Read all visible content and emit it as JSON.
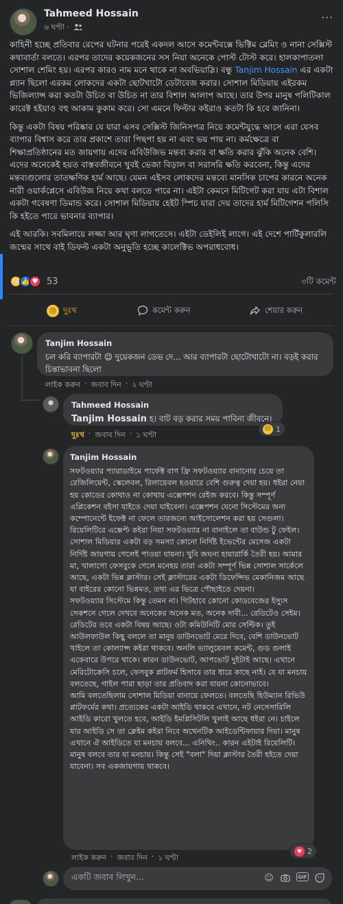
{
  "post": {
    "author": "Tahmeed Hossain",
    "time": "৬ ঘণ্টা ·",
    "audience_icon": "friends-icon",
    "more_icon": "more-icon",
    "paragraphs": [
      {
        "before": "কাহিনী হচ্ছে প্রতিবার রেপের ঘটনার পরেই একদল আসে কমেন্টবক্সে ভিক্টিম ব্লেমিং ও নানা সেক্সিস্ট কথাবার্তা বলতে।  এরপর তাদের কয়েকজনের সস নিয়া অনেকে পোস্ট টোস্ট করে। হালকাপাতলা সোশাল শেমিং হয়। এরপর কারও নাম মনে থাকে না অবভিয়াস্লি। বন্ধু ",
        "mention": "Tanjim Hossain",
        "after": " এর একটা প্ল্যান ছিলো এরকম লোকদের একটা ছোটখাটো ডেটাবেজ করার। সোশাল মিডিয়ায় এইরকম ভিজিল্যান্স করা কতটা উচিত বা উচিত না তার বিশাল আলাপ আছে। তার উপর মানুষ পলিটিকাল কারেক্ট হইয়াও বহু আকাম কুকাম করে। সো এমনে ফিল্টার কইরাও কতটা কি হবে জানিনা।"
      },
      {
        "text": "কিন্তু একটা বিষয় পরিষ্কার যে যারা এসব সেক্সিস্ট জিনিসপত্র নিয়ে কমেন্টযুদ্ধে আসে এরা যেসব ব্যাপার বিশ্বাস করে তার প্রকাশে তারা পিছপা হয় না এবং ভয় পায় না। কর্মক্ষেত্রে বা শিক্ষাপ্রতিষ্ঠানের মত জায়গায় এদের এবিউজিভ মন্তব্য করার বা ক্ষতি করার ঝুঁকি অনেক বেশি। এদের অনেকেই হয়ত বাস্তবজীবনে খুবই ভেজা বিড়াল বা সরাসরি ক্ষতি করবেনা, কিন্তু এদের মন্তব্যগুলোর তাতক্ষণিক হার্ম আছে। যেমন এইসব লোকদের মন্তব্যে মানসিক চাপের কারনে অনেক নারী ওয়ার্কপ্লেসে এবিউজ নিয়ে কথা বলতে পারে না। এইটা কেমনে মিটিগেট করা যায় এটা বিশাল একটা গবেষণা ডিমান্ড করে। সোশাল মিডিয়ায় হেইট স্পিচ যারা দেয় তাদের হার্ম মিটিগেশন পলিসি কি হইতে পারে ভাবনার ব্যাপার।"
      },
      {
        "text": "এই আরকি। সবমিলায়ে লজ্জা আর ঘৃণা লাগতেসে। এইটা ডেইলিই লাগে। এই দেশে পার্টিকুলারলি জন্মের সাথে বাই ডিফল্ট একটা অনুভূতি হচ্ছে কালেক্টিভ অপরাধবোধ।"
      }
    ],
    "reactions": {
      "icons": [
        "sad-icon",
        "like-icon",
        "love-icon"
      ],
      "count": "53",
      "comments": "৩টি কমেন্ট"
    },
    "actions": [
      {
        "label": "দুঃখ",
        "icon": "sad-icon",
        "active": true
      },
      {
        "label": "কমেন্ট করুন",
        "icon": "comment-icon",
        "active": false
      },
      {
        "label": "শেয়ার করুন",
        "icon": "share-icon",
        "active": false
      }
    ]
  },
  "comments": [
    {
      "name": "Tanjim Hossain",
      "text_before": "চল করি ব্যাপারটা ",
      "emoji": "😉",
      "text_after": " দুয়েকজন ডেভ দে... আর ব্যাপারটা ছোটোখাটো না। বড়ই করার চিন্তাভাবনা ছিলো",
      "links": [
        "লাইক করুন",
        "জবাব দিন",
        "২ ঘণ্টা"
      ]
    },
    {
      "name": "Tahmeed Hossain",
      "mention": "Tanjim Hossain",
      "text": " হ। বাট বড় করার সময় পাবিনা জীবনে।",
      "links": [
        "দুঃখ",
        "জবাব দিন",
        "১ ঘণ্টা"
      ],
      "reaction_count": "1"
    },
    {
      "name": "Tanjim Hossain",
      "paragraphs": [
        "সফটওয়্যার প্যারাডাইমে পার্ফেক্ট বাগ ফ্রি সফটওয়্যার বানানোর চেয়ে তা রেজিলিয়েন্ট, স্কেলেবল, রিলায়েবল হওয়ারে বেশি গুরুত্ব দেয়া হয়। ধইরা নেয়া হয় কোডের কোথাও না কোথায় এক্সেপশন রেইজ করবে। কিন্তু সম্পূর্ণ এপ্লিকেশন বইসা যাইতে দেয়া যাইবেনা। এক্সেপশন যেনো সিস্টেমের অন্য কম্পোনেন্টে ইফেক্ট না ফেলে তারজন্যে আইসোলেশন করা হয় সেগুলা। রিয়েলিটিরে এক্সেপ্ট কইরা নিয়া সফটওয়্যার না বানাইলে তা বাউন্ড টু ফেইল।",
        "সোশাল মিডিয়ার একটা বড় সমস্যা কোনো নির্দিষ্ট ইভেন্টের মেসেজ একটা নির্দিষ্ট জায়গায় গেলেই পাওয়া যায়না। খুবি জঘন্য হায়ারার্কি তৈরী হয়। আমার মা, খালাগো ফেসবুকে গেলে মনেহয় তারা একটা সম্পূর্ণ ভিন্ন সোশাল সার্কেলে আছে, একটা ভিন্ন ক্লাস্টার। সেই ক্লাস্টারের একটা ডিফেন্সিভ মেকানিজম আছে যা বাইরের কোনো ভিন্নমত, তথ্য এর ভিত্রে পৌছাইতে দেয়না।",
        "সফটওয়্যার সিস্টেমে কিন্তু তেমন না। গিটহাবে কোনো কোডবেজের ইস্যুস সেকশনে গেলে দেখবে অনেকের অনেক মত, অনেক দাবী... রেডিটেও সেইম। রেডিটের তবে একটা বিষয় আছে। ওটা কমিউনিটি মোর সেল্টিক। তুই আউলফাউল কিছু বললে তা মানুষ ডাউনভোট মেরে দিবে, বেশি ডাউনভোট খাইলে তা কোল্যাপ্স কইরা থাকবে। অনলি ভ্যালুয়েবল কমেন্ট, গুড গুলাই একেবারে উপরে থাকে। কারন ডাউনভোট, আপভোট দুইটাই আছে। এখানে মেরিটোক্রেসি চলে, ফেসবুক প্লাটফর্ম হিসাবে তার ধারে কাছে নাই। যে যা মনচায় বলতেছে, গাইল পারা ছাড়া তার প্রতিবাদ করা যায়না কোনোভাবে।",
        "আমি বলতেছিলাম সোশাল মিডিয়া বানায়ে ফেলতে। বলতেছি হিউম্যান রিভিউ প্লাটফর্মের কথা। প্রত্যেকের একটা আইডি থাকবে এখানে, নট নেসেসারিলি আইডি কারো খুলতে হবে, আইডি ইমপ্লিসিটলি খুলাই আছে ধইরা নে। চাইলে যার আইডি সে তা ক্লেইম কইরা নিবে অথেনটিক আইডেন্টিফায়ার দিয়া। মানুষ এখানে ঐ আইডিতে যা মনচায় বলবে... এনিথিং.. কারন এইটাই রিয়েলিটি। মানুষ বলবে তার যা মনচায়। কিন্তু সেই \"বলা\" দিয়া ক্লাস্টার তৈরী হইতে দেয়া যাবেনা। সব একজায়গায় থাকবে।"
      ],
      "links": [
        "লাইক করুন",
        "জবাব দিন",
        "১ ঘণ্টা"
      ],
      "reaction_count": "2"
    }
  ],
  "reply_box": {
    "placeholder": "একটি জবাব লিখুন...",
    "icons": [
      "smiley-icon",
      "camera-icon",
      "gif-icon",
      "sticker-icon"
    ]
  }
}
